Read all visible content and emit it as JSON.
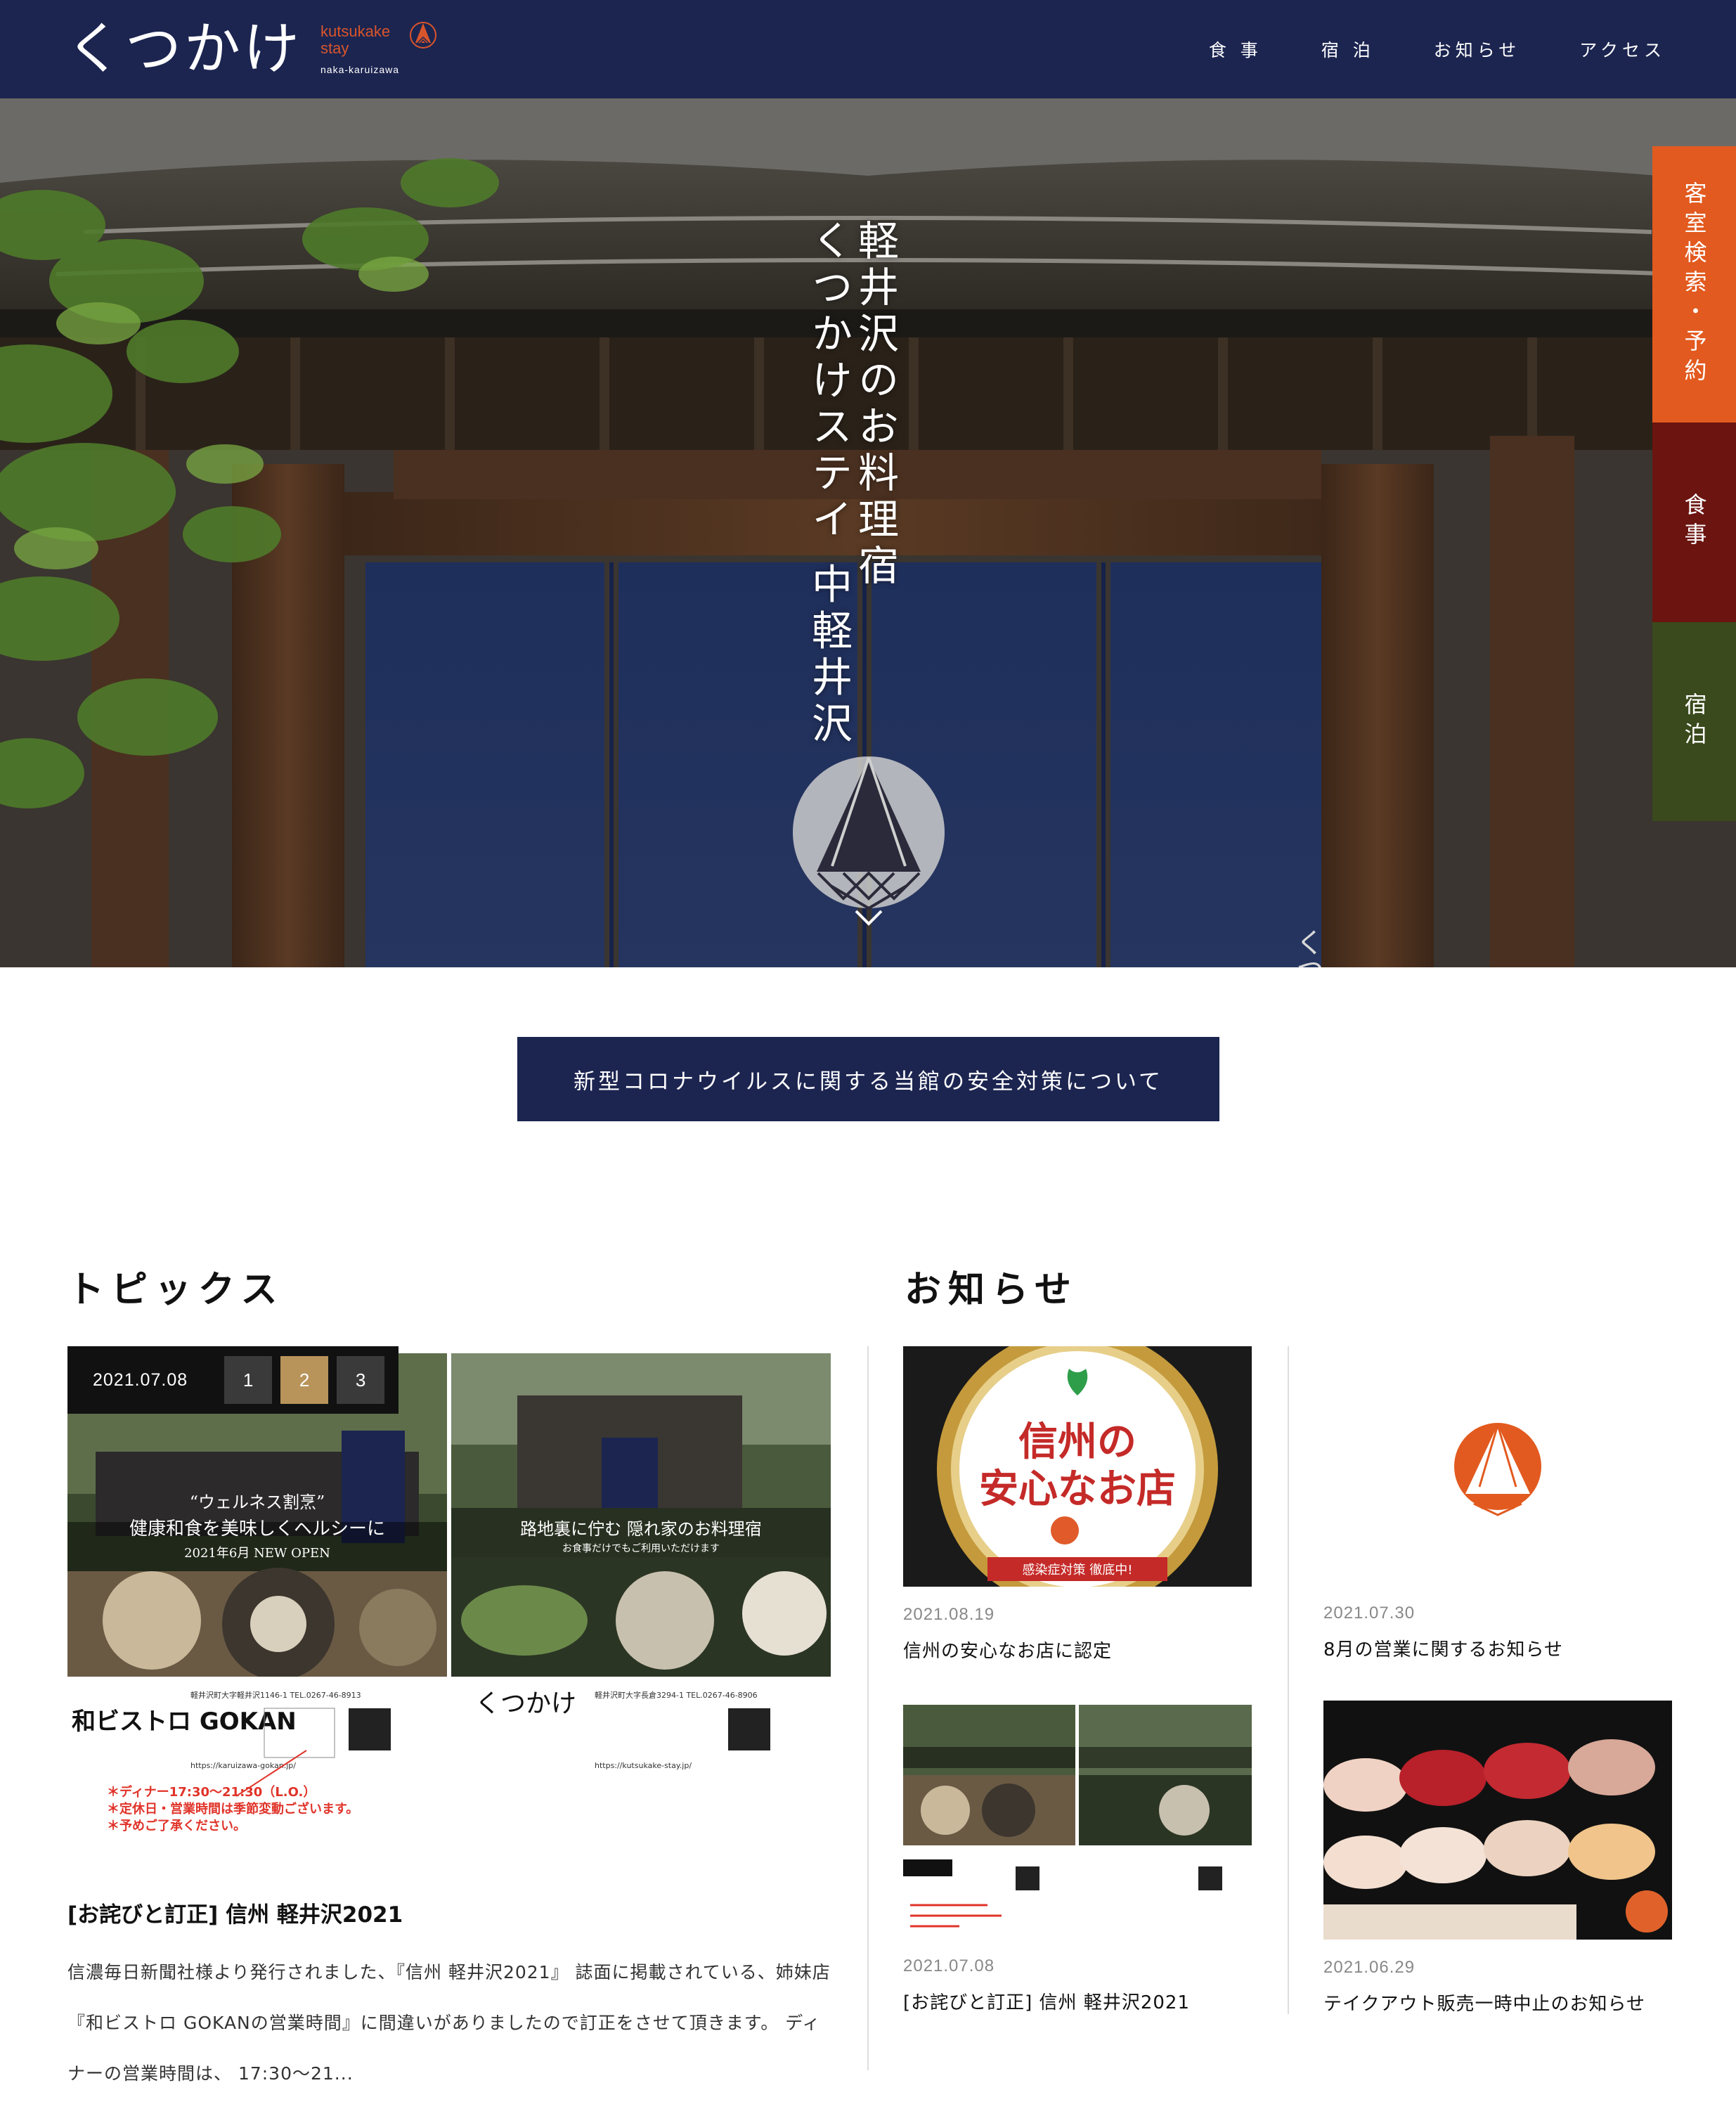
{
  "header": {
    "logo_script": "くつかけ",
    "logo_en_line1": "kutsukake",
    "logo_en_line2": "stay",
    "logo_area": "naka-karuizawa",
    "nav": [
      "食 事",
      "宿 泊",
      "お知らせ",
      "アクセス"
    ]
  },
  "hero": {
    "title_line1": "軽井沢のお料理宿",
    "title_line2": "くつかけステイ 中軽井沢",
    "noren_text": "くつ"
  },
  "side_tabs": {
    "reserve": "客室検索・予約",
    "food": "食事",
    "stay": "宿泊"
  },
  "safety_banner": "新型コロナウイルスに関する当館の安全対策について",
  "topics": {
    "heading": "トピックス",
    "date": "2021.07.08",
    "pages": [
      "1",
      "2",
      "3"
    ],
    "active_page": "2",
    "flyer": {
      "left_catch": "“ウェルネス割烹”",
      "left_catch2": "健康和食を美味しくヘルシーに",
      "left_open": "2021年6月 NEW OPEN",
      "right_catch": "路地裏に佇む 隠れ家のお料理宿",
      "right_sub": "お食事だけでもご利用いただけます",
      "left_brand": "和ビストロ GOKAN",
      "right_brand": "くつかけ",
      "left_addr": "軽井沢町大字軽井沢1146-1 TEL.0267-46-8913",
      "right_addr": "軽井沢町大字長倉3294-1 TEL.0267-46-8906",
      "left_url": "https://karuizawa-gokan.jp/",
      "right_url": "https://kutsukake-stay.jp/",
      "note1": "＊ディナー17:30〜21:30（L.O.）",
      "note2": "＊定休日・営業時間は季節変動ございます。",
      "note3": "＊予めご了承ください。"
    },
    "title": "[お詫びと訂正] 信州 軽井沢2021",
    "body": "信濃毎日新聞社様より発行されました、『信州 軽井沢2021』 誌面に掲載されている、姉妹店 『和ビストロ GOKANの営業時間』に間違いがありましたので訂正をさせて頂きます。 ディナーの営業時間は、 17:30〜21..."
  },
  "news": {
    "heading": "お知らせ",
    "badge_text_1": "信州の",
    "badge_text_2": "安心なお店",
    "badge_ribbon": "感染症対策 徹底中!",
    "items": [
      {
        "date": "2021.08.19",
        "title": "信州の安心なお店に認定"
      },
      {
        "date": "2021.07.30",
        "title": "8月の営業に関するお知らせ"
      },
      {
        "date": "2021.07.08",
        "title": "[お詫びと訂正] 信州 軽井沢2021"
      },
      {
        "date": "2021.06.29",
        "title": "テイクアウト販売一時中止のお知らせ"
      }
    ]
  },
  "colors": {
    "navy": "#1c2550",
    "orange": "#e25a1f",
    "maroon": "#6b1410",
    "olive": "#3a4a1c",
    "gold": "#b8935a"
  }
}
